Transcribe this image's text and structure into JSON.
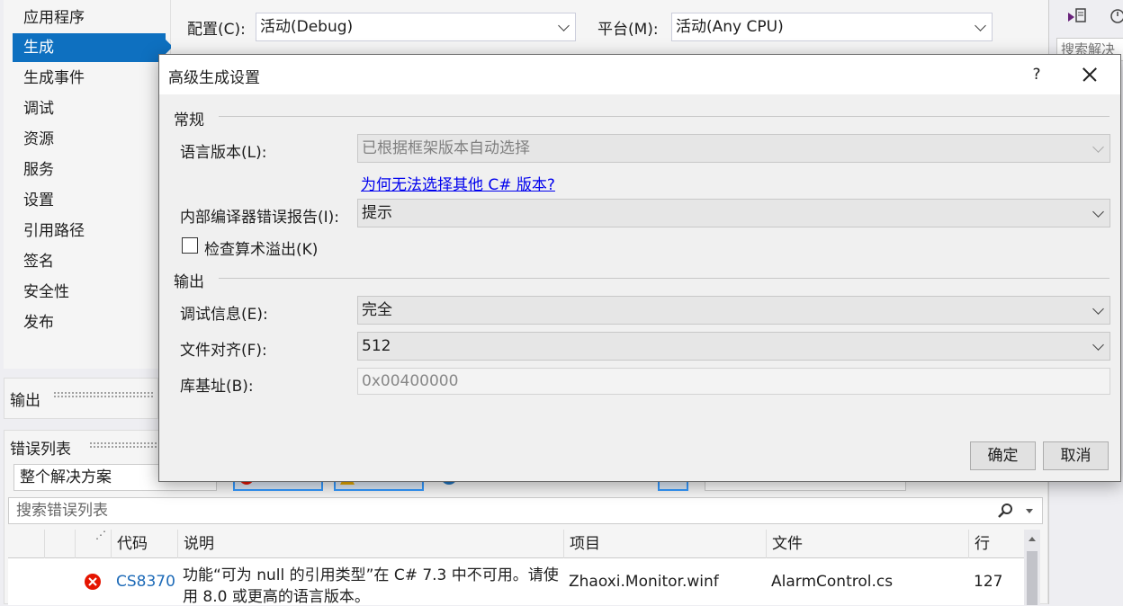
{
  "nav": {
    "items": [
      "应用程序",
      "生成",
      "生成事件",
      "调试",
      "资源",
      "服务",
      "设置",
      "引用路径",
      "签名",
      "安全性",
      "发布"
    ],
    "selected_index": 1
  },
  "config_bar": {
    "config_label": "配置(C):",
    "config_value": "活动(Debug)",
    "platform_label": "平台(M):",
    "platform_value": "活动(Any CPU)"
  },
  "right_panel": {
    "search_text": "搜索解决"
  },
  "output_pane": {
    "title": "输出"
  },
  "error_list": {
    "title": "错误列表",
    "scope": "整个解决方案",
    "search_placeholder": "搜索错误列表",
    "columns": [
      "代码",
      "说明",
      "项目",
      "文件",
      "行"
    ],
    "rows": [
      {
        "code": "CS8370",
        "description_line1": "功能“可为 null 的引用类型”在 C# 7.3 中不可用。请使",
        "description_line2": "用 8.0 或更高的语言版本。",
        "project": "Zhaoxi.Monitor.winf",
        "file": "AlarmControl.cs",
        "line": "127"
      }
    ]
  },
  "dialog": {
    "title": "高级生成设置",
    "help": "?",
    "general_header": "常规",
    "lang_version_label": "语言版本(L):",
    "lang_version_value": "已根据框架版本自动选择",
    "why_link": "为何无法选择其他 C# 版本?",
    "compiler_report_label": "内部编译器错误报告(I):",
    "compiler_report_value": "提示",
    "overflow_label": "检查算术溢出(K)",
    "overflow_checked": false,
    "output_header": "输出",
    "debug_info_label": "调试信息(E):",
    "debug_info_value": "完全",
    "file_align_label": "文件对齐(F):",
    "file_align_value": "512",
    "base_address_label": "库基址(B):",
    "base_address_value": "0x00400000",
    "ok": "确定",
    "cancel": "取消"
  },
  "colors": {
    "accent": "#0e70c0",
    "error": "#e51400",
    "link": "#0000ee"
  }
}
